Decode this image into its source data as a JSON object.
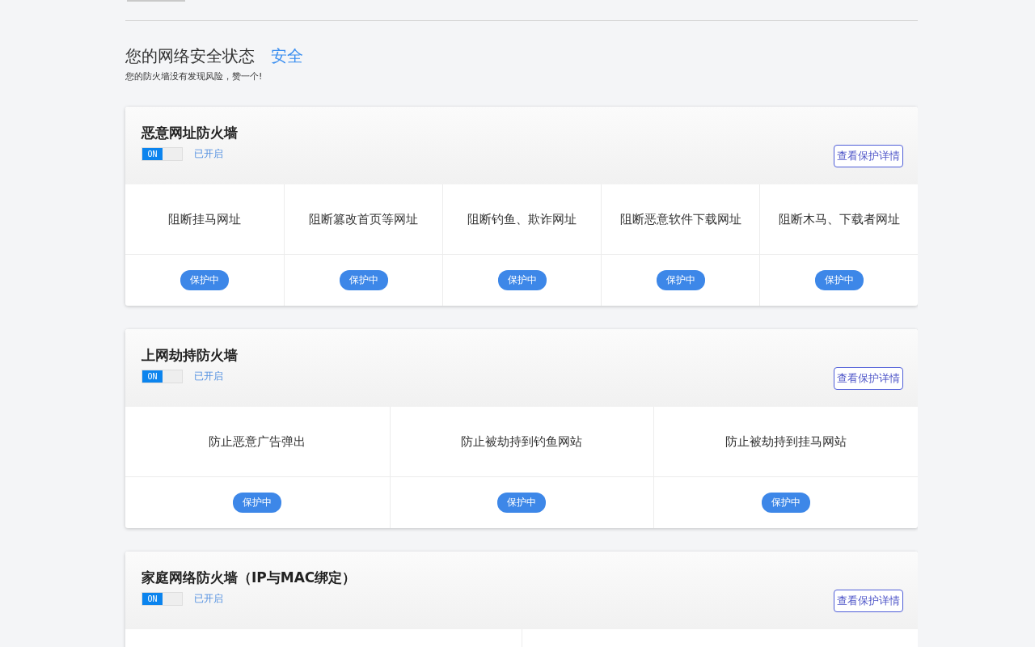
{
  "status": {
    "title": "您的网络安全状态",
    "level_text": "安全",
    "subtitle": "您的防火墙没有发现风险，赞一个!"
  },
  "cards": [
    {
      "title": "恶意网址防火墙",
      "toggle": {
        "on": true,
        "label": "ON"
      },
      "state_text": "已开启",
      "details_button": "查看保护详情",
      "items": [
        {
          "kind": "feature",
          "label": "阻断挂马网址",
          "badge": "保护中"
        },
        {
          "kind": "feature",
          "label": "阻断篡改首页等网址",
          "badge": "保护中"
        },
        {
          "kind": "feature",
          "label": "阻断钓鱼、欺诈网址",
          "badge": "保护中"
        },
        {
          "kind": "feature",
          "label": "阻断恶意软件下载网址",
          "badge": "保护中"
        },
        {
          "kind": "feature",
          "label": "阻断木马、下载者网址",
          "badge": "保护中"
        }
      ]
    },
    {
      "title": "上网劫持防火墙",
      "toggle": {
        "on": true,
        "label": "ON"
      },
      "state_text": "已开启",
      "details_button": "查看保护详情",
      "items": [
        {
          "kind": "feature",
          "label": "防止恶意广告弹出",
          "badge": "保护中"
        },
        {
          "kind": "feature",
          "label": "防止被劫持到钓鱼网站",
          "badge": "保护中"
        },
        {
          "kind": "feature",
          "label": "防止被劫持到挂马网站",
          "badge": "保护中"
        }
      ]
    },
    {
      "title": "家庭网络防火墙（IP与MAC绑定）",
      "toggle": {
        "on": true,
        "label": "ON"
      },
      "state_text": "已开启",
      "details_button": "查看保护详情",
      "items": [
        {
          "kind": "blank"
        },
        {
          "kind": "blank"
        }
      ]
    }
  ]
}
